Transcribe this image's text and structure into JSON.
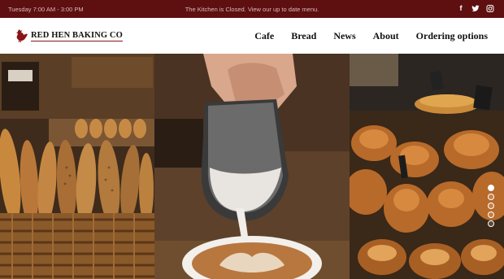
{
  "topbar": {
    "hours": "Tuesday  7:00 AM - 3:00 PM",
    "notice": "The Kitchen is Closed.  View our up to date menu.",
    "social": [
      "facebook-icon",
      "twitter-icon",
      "instagram-icon"
    ]
  },
  "brand": {
    "name": "RED HEN BAKING CO",
    "accent": "#8a1515",
    "topbar_color": "#5e0f10"
  },
  "nav": {
    "items": [
      "Cafe",
      "Bread",
      "News",
      "About",
      "Ordering options"
    ]
  },
  "slider": {
    "count": 5,
    "active": 0
  }
}
